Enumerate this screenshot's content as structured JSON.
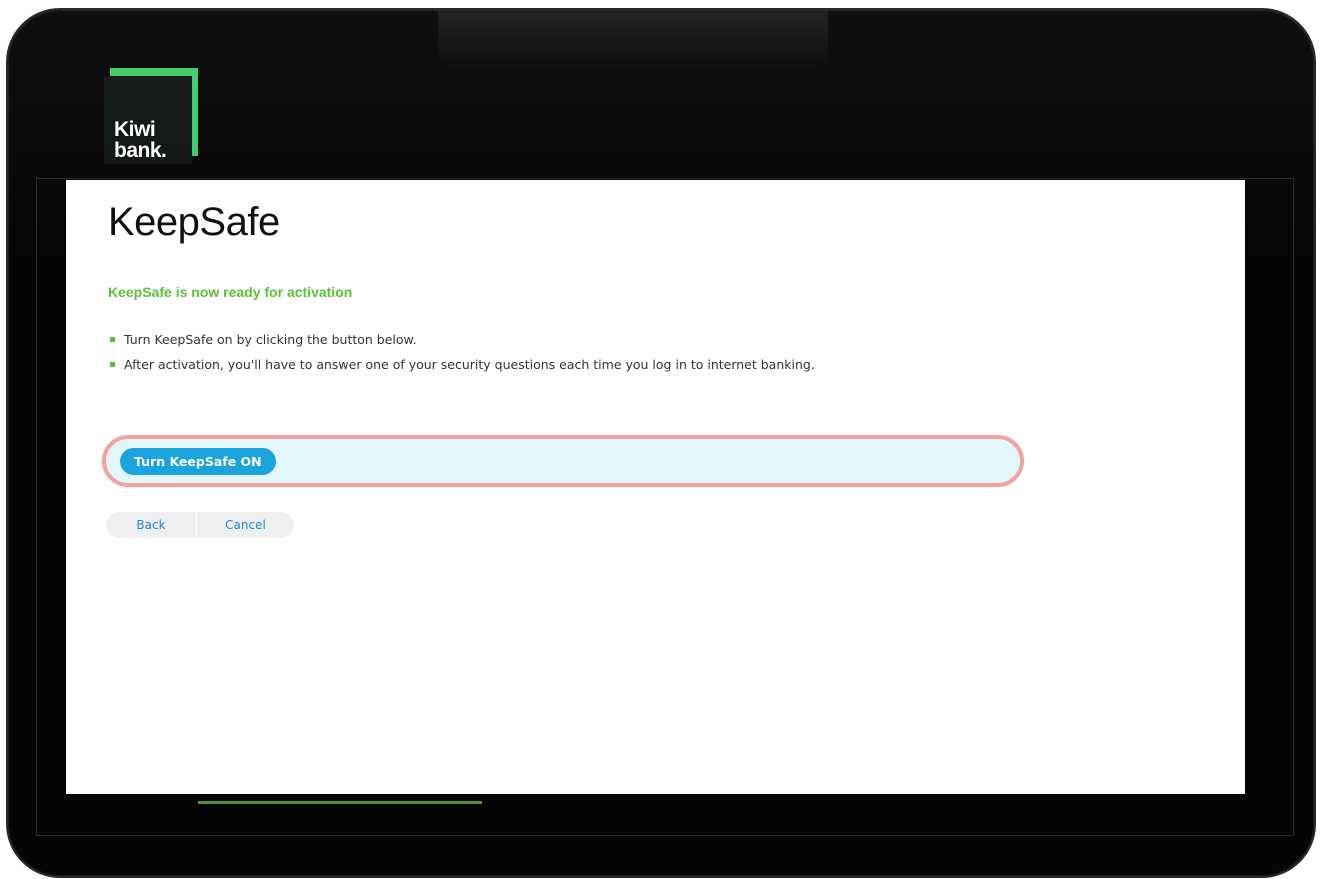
{
  "brand": {
    "logo_text": "Kiwi\nbank."
  },
  "page": {
    "title": "KeepSafe",
    "subtitle": "KeepSafe is now ready for activation",
    "instructions": [
      "Turn KeepSafe on by clicking the button below.",
      "After activation, you'll have to answer one of your security questions each time you log in to internet banking."
    ]
  },
  "actions": {
    "primary_label": "Turn KeepSafe ON",
    "back_label": "Back",
    "cancel_label": "Cancel"
  },
  "colors": {
    "brand_green": "#3ecb6a",
    "subtitle_green": "#5cbf3a",
    "button_blue": "#1aa3dd",
    "highlight_border": "#f2a3a0",
    "highlight_fill": "#e3f6fb"
  }
}
